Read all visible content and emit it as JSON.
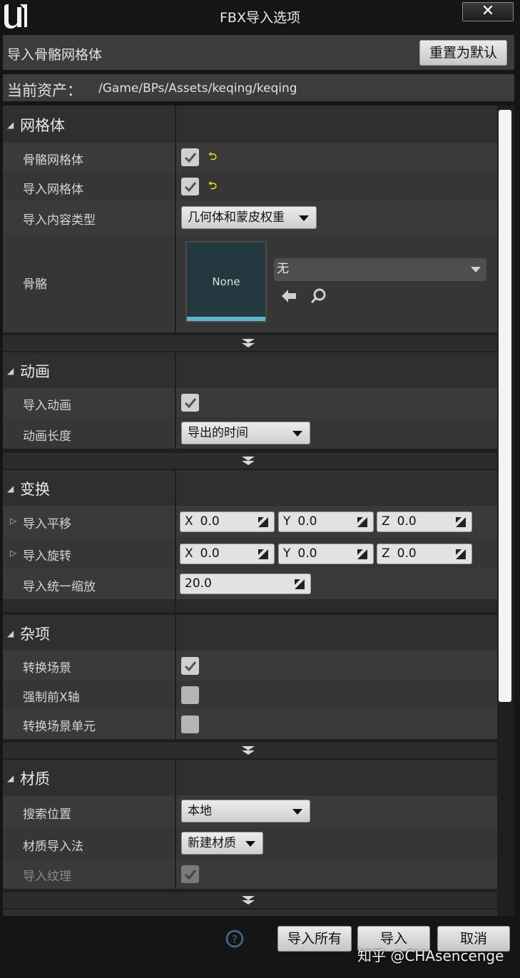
{
  "window": {
    "title": "FBX导入选项",
    "close_label": "✕"
  },
  "header": {
    "import_type": "导入骨骼网格体",
    "reset_label": "重置为默认",
    "current_asset_label": "当前资产：",
    "current_asset_path": "/Game/BPs/Assets/keqing/keqing"
  },
  "mesh": {
    "title": "网格体",
    "skeletal_mesh_label": "骨骼网格体",
    "skeletal_mesh_checked": true,
    "import_mesh_label": "导入网格体",
    "import_mesh_checked": true,
    "content_type_label": "导入内容类型",
    "content_type_value": "几何体和蒙皮权重",
    "skeleton_label": "骨骼",
    "skeleton_thumb": "None",
    "skeleton_value": "无"
  },
  "animation": {
    "title": "动画",
    "import_anim_label": "导入动画",
    "import_anim_checked": true,
    "anim_length_label": "动画长度",
    "anim_length_value": "导出的时间"
  },
  "transform": {
    "title": "变换",
    "translation_label": "导入平移",
    "translation": {
      "x_axis": "X",
      "x": "0.0",
      "y_axis": "Y",
      "y": "0.0",
      "z_axis": "Z",
      "z": "0.0"
    },
    "rotation_label": "导入旋转",
    "rotation": {
      "x_axis": "X",
      "x": "0.0",
      "y_axis": "Y",
      "y": "0.0",
      "z_axis": "Z",
      "z": "0.0"
    },
    "uniform_scale_label": "导入统一缩放",
    "uniform_scale_value": "20.0"
  },
  "misc": {
    "title": "杂项",
    "convert_scene_label": "转换场景",
    "convert_scene_checked": true,
    "force_front_x_label": "强制前X轴",
    "force_front_x_checked": false,
    "convert_scene_unit_label": "转换场景单元",
    "convert_scene_unit_checked": false
  },
  "material": {
    "title": "材质",
    "search_location_label": "搜索位置",
    "search_location_value": "本地",
    "import_method_label": "材质导入法",
    "import_method_value": "新建材质",
    "import_textures_label": "导入纹理",
    "import_textures_checked": true
  },
  "footer": {
    "import_all_label": "导入所有",
    "import_label": "导入",
    "cancel_label": "取消",
    "watermark": "知乎 @CHAsencenge"
  },
  "colors": {
    "panel_bg": "#3a3a3a",
    "category_bg": "#2f2f2f",
    "accent_bar": "#5fb4c8",
    "reset_arrow": "#d8d020"
  }
}
